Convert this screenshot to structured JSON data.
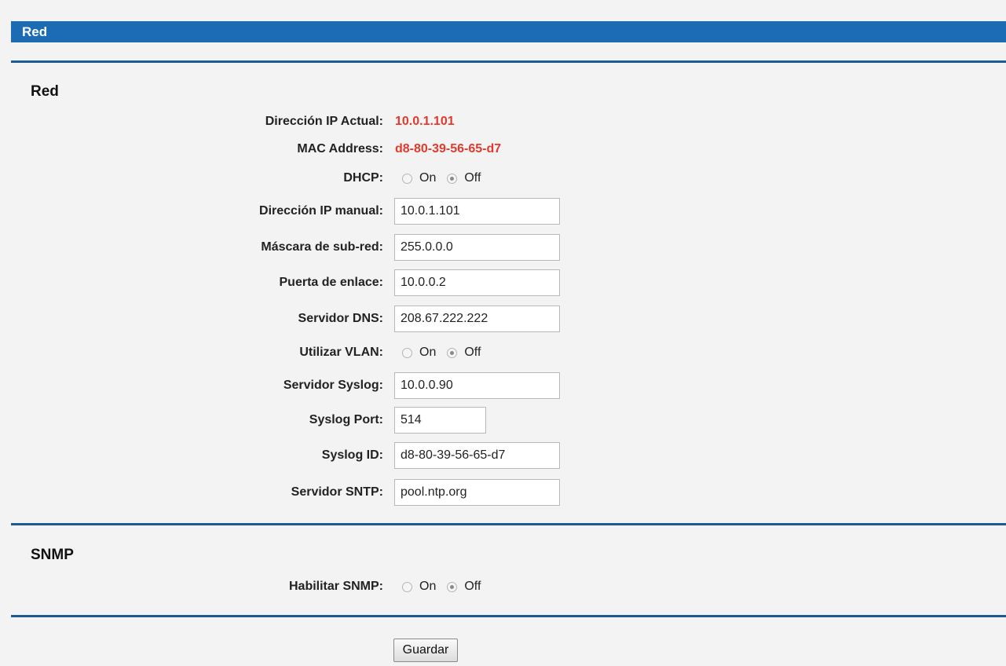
{
  "header": {
    "title": "Red"
  },
  "network": {
    "section_title": "Red",
    "current_ip": {
      "label": "Dirección IP Actual:",
      "value": "10.0.1.101"
    },
    "mac_address": {
      "label": "MAC Address:",
      "value": "d8-80-39-56-65-d7"
    },
    "dhcp": {
      "label": "DHCP:",
      "on_label": "On",
      "off_label": "Off",
      "selected": "Off"
    },
    "manual_ip": {
      "label": "Dirección IP manual:",
      "value": "10.0.1.101"
    },
    "subnet_mask": {
      "label": "Máscara de sub-red:",
      "value": "255.0.0.0"
    },
    "gateway": {
      "label": "Puerta de enlace:",
      "value": "10.0.0.2"
    },
    "dns_server": {
      "label": "Servidor DNS:",
      "value": "208.67.222.222"
    },
    "vlan": {
      "label": "Utilizar VLAN:",
      "on_label": "On",
      "off_label": "Off",
      "selected": "Off"
    },
    "syslog_server": {
      "label": "Servidor Syslog:",
      "value": "10.0.0.90"
    },
    "syslog_port": {
      "label": "Syslog Port:",
      "value": "514"
    },
    "syslog_id": {
      "label": "Syslog ID:",
      "value": "d8-80-39-56-65-d7"
    },
    "sntp_server": {
      "label": "Servidor SNTP:",
      "value": "pool.ntp.org"
    }
  },
  "snmp": {
    "section_title": "SNMP",
    "enable": {
      "label": "Habilitar SNMP:",
      "on_label": "On",
      "off_label": "Off",
      "selected": "Off"
    }
  },
  "actions": {
    "save_label": "Guardar"
  },
  "colors": {
    "header_bar": "#1c6bb5",
    "divider": "#1c5a95",
    "highlight_value": "#e03a2c",
    "page_background": "#f3f3f3"
  }
}
